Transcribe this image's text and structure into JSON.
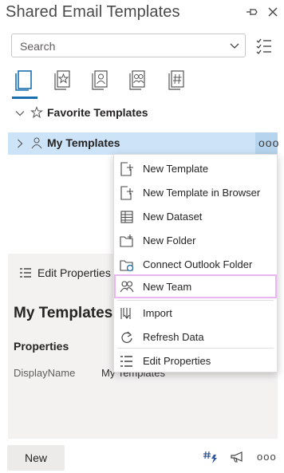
{
  "window": {
    "title": "Shared Email Templates"
  },
  "search": {
    "placeholder": "Search"
  },
  "tree": {
    "favorites_label": "Favorite Templates",
    "my_templates_label": "My Templates",
    "more_dots": "ooo"
  },
  "details": {
    "edit_properties_label": "Edit Properties",
    "name": "My Templates",
    "properties_heading": "Properties",
    "display_name_key": "DisplayName",
    "display_name_value": "My Templates"
  },
  "context_menu": {
    "items": [
      {
        "label": "New Template",
        "icon": "new-template-icon"
      },
      {
        "label": "New Template in Browser",
        "icon": "new-template-browser-icon"
      },
      {
        "label": "New Dataset",
        "icon": "dataset-icon"
      },
      {
        "label": "New Folder",
        "icon": "new-folder-icon"
      },
      {
        "label": "Connect Outlook Folder",
        "icon": "outlook-folder-icon"
      },
      {
        "label": "New Team",
        "icon": "team-icon",
        "highlighted": true
      },
      {
        "label": "Import",
        "icon": "import-icon"
      },
      {
        "label": "Refresh Data",
        "icon": "refresh-icon"
      },
      {
        "label": "Edit Properties",
        "icon": "edit-properties-icon"
      }
    ]
  },
  "footer": {
    "new_label": "New",
    "more_dots": "ooo"
  },
  "colors": {
    "accent": "#1a6fb0",
    "selected_row": "#cde3f7",
    "highlight_border": "#e9b6f2",
    "panel_bg": "#f3f2f1"
  }
}
